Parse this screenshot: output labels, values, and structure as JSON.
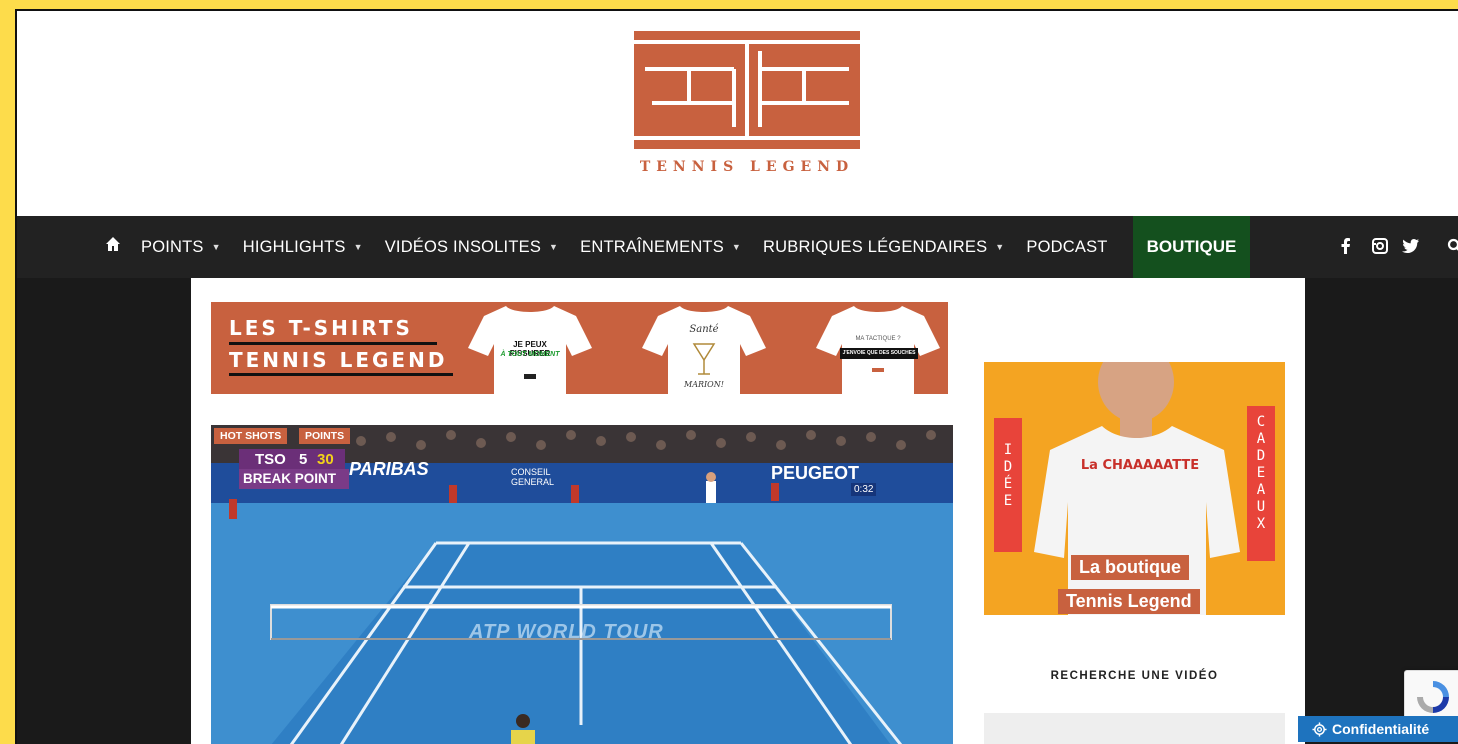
{
  "site": {
    "logo_text": "TENNIS LEGEND",
    "brand_color": "#c8613f"
  },
  "nav": {
    "home_icon": "home-icon",
    "items": [
      {
        "label": "POINTS",
        "has_dropdown": true
      },
      {
        "label": "HIGHLIGHTS",
        "has_dropdown": true
      },
      {
        "label": "VIDÉOS INSOLITES",
        "has_dropdown": true
      },
      {
        "label": "ENTRAÎNEMENTS",
        "has_dropdown": true
      },
      {
        "label": "RUBRIQUES LÉGENDAIRES",
        "has_dropdown": true
      },
      {
        "label": "PODCAST",
        "has_dropdown": false
      }
    ],
    "boutique": "BOUTIQUE",
    "boutique_color": "#14501e",
    "social": [
      "facebook-icon",
      "instagram-icon",
      "twitter-icon",
      "search-icon"
    ]
  },
  "banner": {
    "line1": "LES T-SHIRTS",
    "line2": "TENNIS LEGEND",
    "shirts": [
      {
        "top": "JE PEUX FISSURER",
        "bottom": "À TOUT MOMENT"
      },
      {
        "top": "Santé",
        "bottom": "MARION!"
      },
      {
        "top": "MA TACTIQUE ?",
        "bottom": "J'ENVOIE QUE DES SOUCHES"
      }
    ]
  },
  "video": {
    "tags": [
      "HOT SHOTS",
      "POINTS"
    ],
    "score_player": "TSO",
    "score_games": "5",
    "score_points": "30",
    "score_status": "BREAK POINT",
    "sponsor_1": "PARIBAS",
    "sponsor_2": "CONSEIL GENERAL",
    "sponsor_3": "PEUGEOT",
    "court_text": "ATP WORLD TOUR",
    "clock": "0:32"
  },
  "side_ad": {
    "left_text": "IDÉE",
    "right_text": "CADEAUX",
    "shirt_text": "La CHAAAAATTE",
    "cta1": "La boutique",
    "cta2": "Tennis Legend"
  },
  "search": {
    "title": "RECHERCHE UNE VIDÉO"
  },
  "footer": {
    "privacy": "Confidentialité"
  }
}
